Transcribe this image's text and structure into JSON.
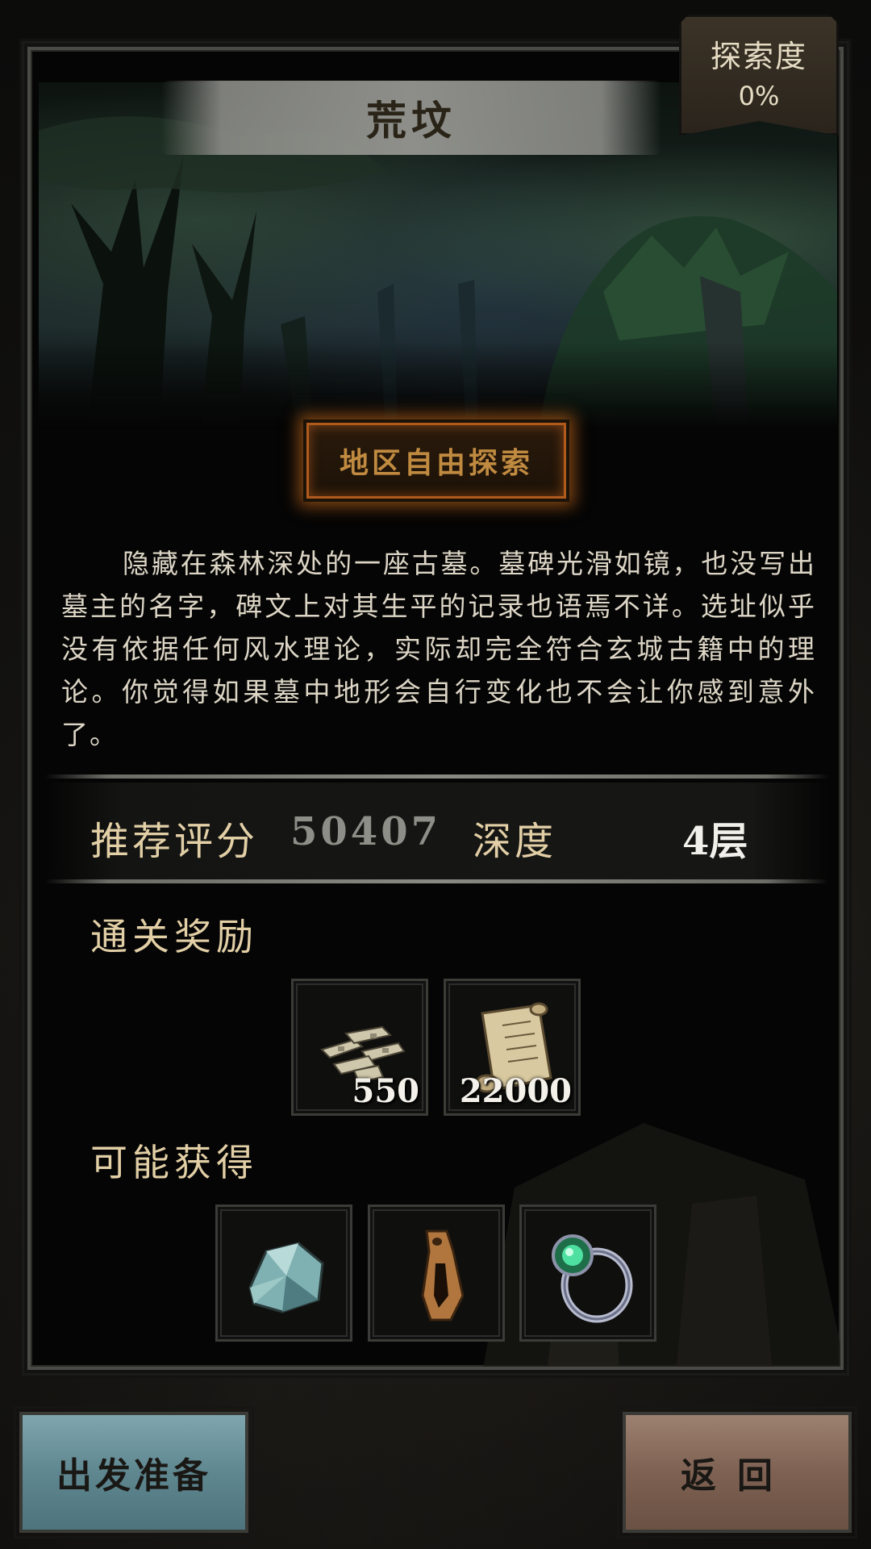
{
  "location": {
    "title": "荒坟",
    "exploration_label": "探索度",
    "exploration_value": "0%"
  },
  "free_explore_button": "地区自由探索",
  "description": "隐藏在森林深处的一座古墓。墓碑光滑如镜，也没写出墓主的名字，碑文上对其生平的记录也语焉不详。选址似乎没有依据任何风水理论，实际却完全符合玄城古籍中的理论。你觉得如果墓中地形会自行变化也不会让你感到意外了。",
  "stats": {
    "recommended_label": "推荐评分",
    "recommended_value": "50407",
    "depth_label": "深度",
    "depth_value": "4层"
  },
  "clear_rewards": {
    "heading": "通关奖励",
    "items": [
      {
        "icon": "silver-ingots-icon",
        "quantity": "550"
      },
      {
        "icon": "scroll-icon",
        "quantity": "22000"
      }
    ]
  },
  "possible_drops": {
    "heading": "可能获得",
    "items": [
      {
        "icon": "ore-crystal-icon"
      },
      {
        "icon": "bronze-talisman-icon"
      },
      {
        "icon": "jade-ring-icon"
      }
    ]
  },
  "buttons": {
    "depart": "出发准备",
    "back": "返回"
  },
  "colors": {
    "accent_gold": "#e2cfa6",
    "button_glow": "#e6781e",
    "depart_button": "#5f8790",
    "back_button": "#7e6152",
    "stat_value_grey": "#8e8e88",
    "stat_value_white": "#f2f0ea"
  }
}
